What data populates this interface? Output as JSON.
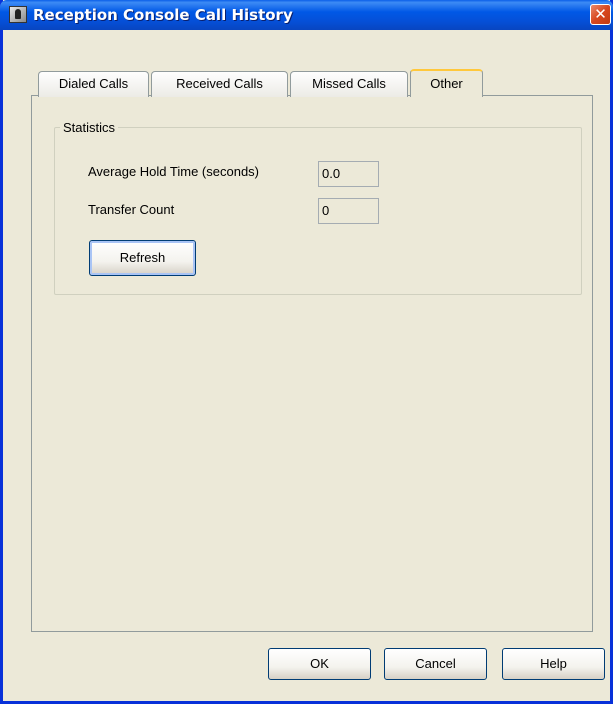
{
  "window": {
    "title": "Reception Console Call History",
    "close_glyph": "✕"
  },
  "tabs": [
    {
      "label": "Dialed Calls",
      "active": false
    },
    {
      "label": "Received Calls",
      "active": false
    },
    {
      "label": "Missed Calls",
      "active": false
    },
    {
      "label": "Other",
      "active": true
    }
  ],
  "statistics": {
    "group_label": "Statistics",
    "avg_hold_label": "Average Hold Time (seconds)",
    "avg_hold_value": "0.0",
    "transfer_label": "Transfer Count",
    "transfer_value": "0",
    "refresh_label": "Refresh"
  },
  "footer": {
    "ok_label": "OK",
    "cancel_label": "Cancel",
    "help_label": "Help"
  },
  "colors": {
    "title_bar": "#0058e6",
    "dialog_bg": "#ece9d8",
    "close_button": "#d8471e",
    "active_tab_accent": "#ffc83c"
  }
}
